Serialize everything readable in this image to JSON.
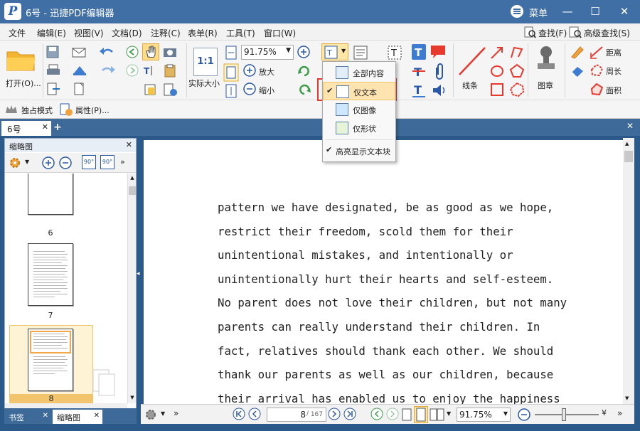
{
  "window": {
    "title": "6号 - 迅捷PDF编辑器",
    "logo_letter": "P",
    "menu_label": "菜单",
    "minimize_glyph": "—",
    "maximize_glyph": "☐",
    "close_glyph": "✕"
  },
  "menubar": {
    "items": [
      "文件",
      "编辑(E)",
      "视图(V)",
      "文档(D)",
      "注释(C)",
      "表单(R)",
      "工具(T)",
      "窗口(W)"
    ],
    "find": "查找(F)",
    "advanced_find": "高级查找(S)"
  },
  "toolbar": {
    "open": "打开(O)...",
    "zoom_value": "91.75%",
    "zoom_in": "放大",
    "zoom_out": "缩小",
    "actual_size": "实际大小",
    "actual_size_icon": "1:1",
    "lines": "线条",
    "stamp": "图章",
    "distance": "距离",
    "perimeter": "周长",
    "area": "面积",
    "exclusive_mode": "独占模式",
    "properties": "属性(P)..."
  },
  "dropdown": {
    "items": [
      {
        "label": "全部内容",
        "checked": false
      },
      {
        "label": "仅文本",
        "checked": true
      },
      {
        "label": "仅图像",
        "checked": false
      },
      {
        "label": "仅形状",
        "checked": false
      }
    ],
    "highlight": {
      "label": "高亮显示文本块",
      "checked": true
    }
  },
  "tabs": {
    "document": "6号",
    "add": "+"
  },
  "sidebar": {
    "title": "缩略图",
    "thumbnails": [
      {
        "page": "6"
      },
      {
        "page": "7"
      },
      {
        "page": "8"
      }
    ],
    "bottom_tabs": [
      "书签",
      "缩略图"
    ],
    "rotate_left": "90°",
    "rotate_right": "90°"
  },
  "document": {
    "lines": [
      "pattern we have designated, be as good as we hope,",
      "restrict their freedom, scold them for their",
      "unintentional mistakes, and intentionally or",
      "unintentionally hurt their hearts and self-esteem.",
      "No parent does not love their children, but not many",
      "parents can really understand their children. In",
      "fact, relatives should thank each other. We should",
      "thank our parents as well as our children, because",
      "their arrival has enabled us to enjoy the happiness"
    ]
  },
  "statusbar": {
    "current_page": "8",
    "total_pages": "167",
    "zoom_value": "91.75%"
  },
  "colors": {
    "title_bar": "#3f6fa4",
    "accent_red": "#e8392f",
    "selected_thumb": "#f3a64a"
  }
}
